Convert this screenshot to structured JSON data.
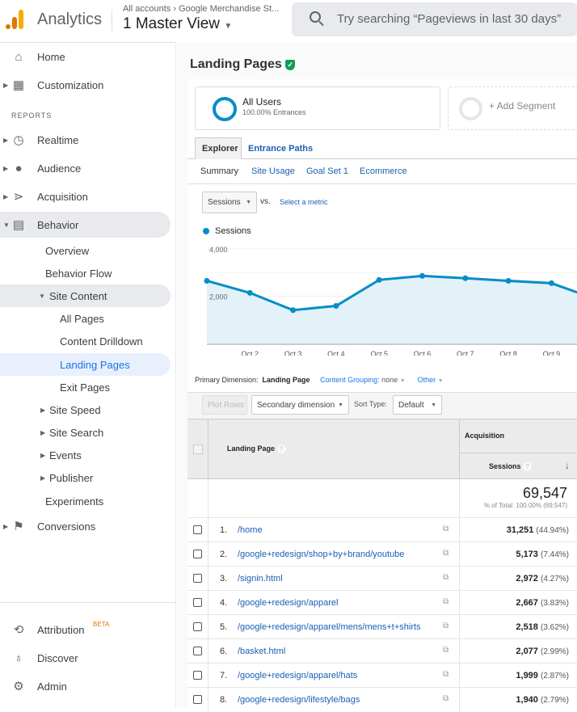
{
  "topbar": {
    "app_name": "Analytics",
    "breadcrumb": "All accounts › Google Merchandise St...",
    "view": "1 Master View",
    "search_placeholder": "Try searching “Pageviews in last 30 days”"
  },
  "sidebar": {
    "reports_label": "REPORTS",
    "items": [
      {
        "label": "Home",
        "icon": "home-icon"
      },
      {
        "label": "Customization",
        "icon": "dashboard-icon"
      },
      {
        "label": "Realtime",
        "icon": "clock-icon"
      },
      {
        "label": "Audience",
        "icon": "person-icon"
      },
      {
        "label": "Acquisition",
        "icon": "acquisition-icon"
      },
      {
        "label": "Behavior",
        "icon": "behavior-icon"
      },
      {
        "label": "Overview"
      },
      {
        "label": "Behavior Flow"
      },
      {
        "label": "Site Content"
      },
      {
        "label": "All Pages"
      },
      {
        "label": "Content Drilldown"
      },
      {
        "label": "Landing Pages"
      },
      {
        "label": "Exit Pages"
      },
      {
        "label": "Site Speed"
      },
      {
        "label": "Site Search"
      },
      {
        "label": "Events"
      },
      {
        "label": "Publisher"
      },
      {
        "label": "Experiments"
      },
      {
        "label": "Conversions",
        "icon": "flag-icon"
      },
      {
        "label": "Attribution",
        "icon": "attribution-icon",
        "badge": "BETA"
      },
      {
        "label": "Discover",
        "icon": "lightbulb-icon"
      },
      {
        "label": "Admin",
        "icon": "gear-icon"
      }
    ]
  },
  "page": {
    "title": "Landing Pages",
    "segment_name": "All Users",
    "segment_sub": "100.00% Entrances",
    "add_segment": "+ Add Segment",
    "tabs": [
      "Explorer",
      "Entrance Paths"
    ],
    "subtabs": [
      "Summary",
      "Site Usage",
      "Goal Set 1",
      "Ecommerce"
    ],
    "metric_select": "Sessions",
    "vs": "vs.",
    "select_metric": "Select a metric",
    "legend": "Sessions",
    "primary_dimension_label": "Primary Dimension:",
    "primary_dimension": "Landing Page",
    "content_grouping": "Content Grouping:",
    "content_grouping_value": "none",
    "other": "Other",
    "plot_rows": "Plot Rows",
    "secondary_dimension": "Secondary dimension",
    "sort_type_label": "Sort Type:",
    "sort_type": "Default"
  },
  "chart_data": {
    "type": "area",
    "x": [
      "...",
      "Oct 2",
      "Oct 3",
      "Oct 4",
      "Oct 5",
      "Oct 6",
      "Oct 7",
      "Oct 8",
      "Oct 9",
      ""
    ],
    "series": [
      {
        "name": "Sessions",
        "values": [
          2650,
          2140,
          1410,
          1590,
          2690,
          2860,
          2760,
          2650,
          2550,
          1900
        ]
      }
    ],
    "yticks": [
      "4,000",
      "2,000"
    ],
    "ylim": [
      0,
      4000
    ],
    "color": "#058dc7"
  },
  "table": {
    "col_landing": "Landing Page",
    "group": "Acquisition",
    "col_sessions": "Sessions",
    "total": "69,547",
    "total_sub": "% of Total: 100.00% (69,547)",
    "rows": [
      {
        "n": "1.",
        "page": "/home",
        "sessions": "31,251",
        "pct": "(44.94%)"
      },
      {
        "n": "2.",
        "page": "/google+redesign/shop+by+brand/youtube",
        "sessions": "5,173",
        "pct": "(7.44%)"
      },
      {
        "n": "3.",
        "page": "/signin.html",
        "sessions": "2,972",
        "pct": "(4.27%)"
      },
      {
        "n": "4.",
        "page": "/google+redesign/apparel",
        "sessions": "2,667",
        "pct": "(3.83%)"
      },
      {
        "n": "5.",
        "page": "/google+redesign/apparel/mens/mens+t+shirts",
        "sessions": "2,518",
        "pct": "(3.62%)"
      },
      {
        "n": "6.",
        "page": "/basket.html",
        "sessions": "2,077",
        "pct": "(2.99%)"
      },
      {
        "n": "7.",
        "page": "/google+redesign/apparel/hats",
        "sessions": "1,999",
        "pct": "(2.87%)"
      },
      {
        "n": "8.",
        "page": "/google+redesign/lifestyle/bags",
        "sessions": "1,940",
        "pct": "(2.79%)"
      }
    ]
  }
}
